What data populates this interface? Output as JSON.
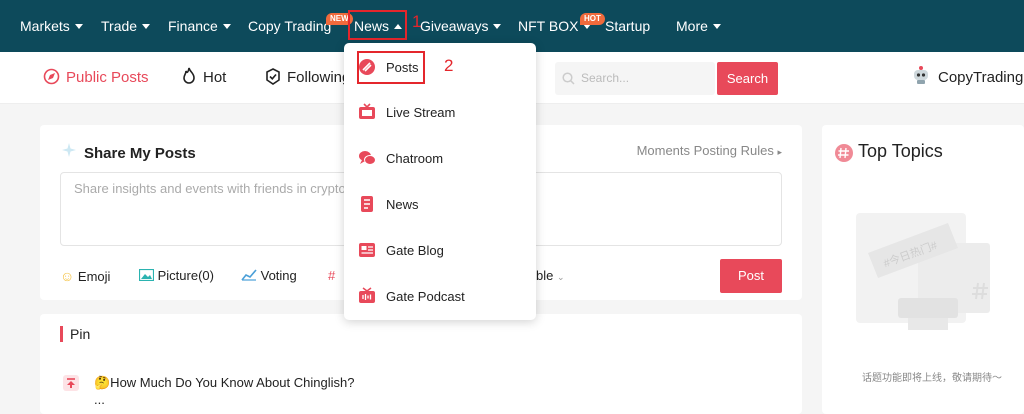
{
  "topnav": {
    "items": [
      {
        "label": "Markets"
      },
      {
        "label": "Trade"
      },
      {
        "label": "Finance"
      },
      {
        "label": "Copy Trading"
      },
      {
        "label": "News"
      },
      {
        "label": "Giveaways"
      },
      {
        "label": "NFT BOX"
      },
      {
        "label": "Startup"
      },
      {
        "label": "More"
      }
    ],
    "badges": {
      "new": "NEW",
      "hot": "HOT"
    }
  },
  "annotations": {
    "step1": "1",
    "step2": "2"
  },
  "news_menu": {
    "items": [
      {
        "label": "Posts",
        "icon": "posts-icon"
      },
      {
        "label": "Live Stream",
        "icon": "tv-icon"
      },
      {
        "label": "Chatroom",
        "icon": "chat-bubbles-icon"
      },
      {
        "label": "News",
        "icon": "document-icon"
      },
      {
        "label": "Gate Blog",
        "icon": "blog-icon"
      },
      {
        "label": "Gate Podcast",
        "icon": "radio-icon"
      }
    ]
  },
  "subnav": {
    "tabs": [
      {
        "label": "Public Posts"
      },
      {
        "label": "Hot"
      },
      {
        "label": "Following"
      }
    ],
    "search_placeholder": "Search...",
    "search_button": "Search",
    "copytrading": "CopyTrading"
  },
  "share": {
    "title": "Share My Posts",
    "rules": "Moments Posting Rules",
    "placeholder": "Share insights and events with friends in crypto",
    "tools": {
      "emoji": "Emoji",
      "picture": "Picture(0)",
      "voting": "Voting",
      "hash": "#",
      "visibility": "ble"
    },
    "post_button": "Post"
  },
  "pin": {
    "title": "Pin",
    "items": [
      {
        "title": "🤔How Much Do You Know About Chinglish?",
        "more": "..."
      }
    ]
  },
  "topics": {
    "title": "Top Topics",
    "placeholder_tag": "#今日热门#",
    "empty_text": "话题功能即将上线，敬请期待～"
  },
  "colors": {
    "accent": "#e8495a",
    "nav_bg": "#0d4a5b",
    "highlight": "#e4262c"
  }
}
